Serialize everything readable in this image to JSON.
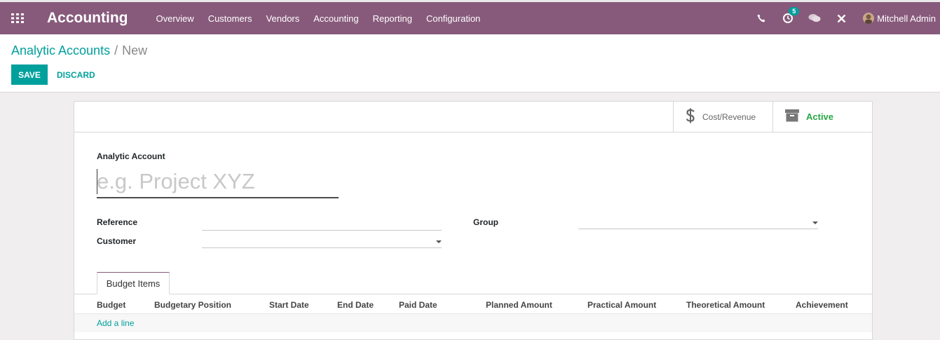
{
  "navbar": {
    "app_title": "Accounting",
    "menu": [
      "Overview",
      "Customers",
      "Vendors",
      "Accounting",
      "Reporting",
      "Configuration"
    ],
    "activity_count": "5",
    "user_name": "Mitchell Admin"
  },
  "breadcrumb": {
    "parent": "Analytic Accounts",
    "separator": "/",
    "current": "New"
  },
  "buttons": {
    "save": "SAVE",
    "discard": "DISCARD"
  },
  "smart_buttons": {
    "cost_revenue": "Cost/Revenue",
    "active": "Active"
  },
  "form": {
    "name_label": "Analytic Account",
    "name_placeholder": "e.g. Project XYZ",
    "reference_label": "Reference",
    "customer_label": "Customer",
    "group_label": "Group"
  },
  "tabs": [
    "Budget Items"
  ],
  "table": {
    "columns": [
      "Budget",
      "Budgetary Position",
      "Start Date",
      "End Date",
      "Paid Date",
      "Planned Amount",
      "Practical Amount",
      "Theoretical Amount",
      "Achievement"
    ],
    "add_line": "Add a line"
  },
  "colors": {
    "brand": "#875a7b",
    "accent": "#00a09d",
    "active": "#28a745"
  }
}
